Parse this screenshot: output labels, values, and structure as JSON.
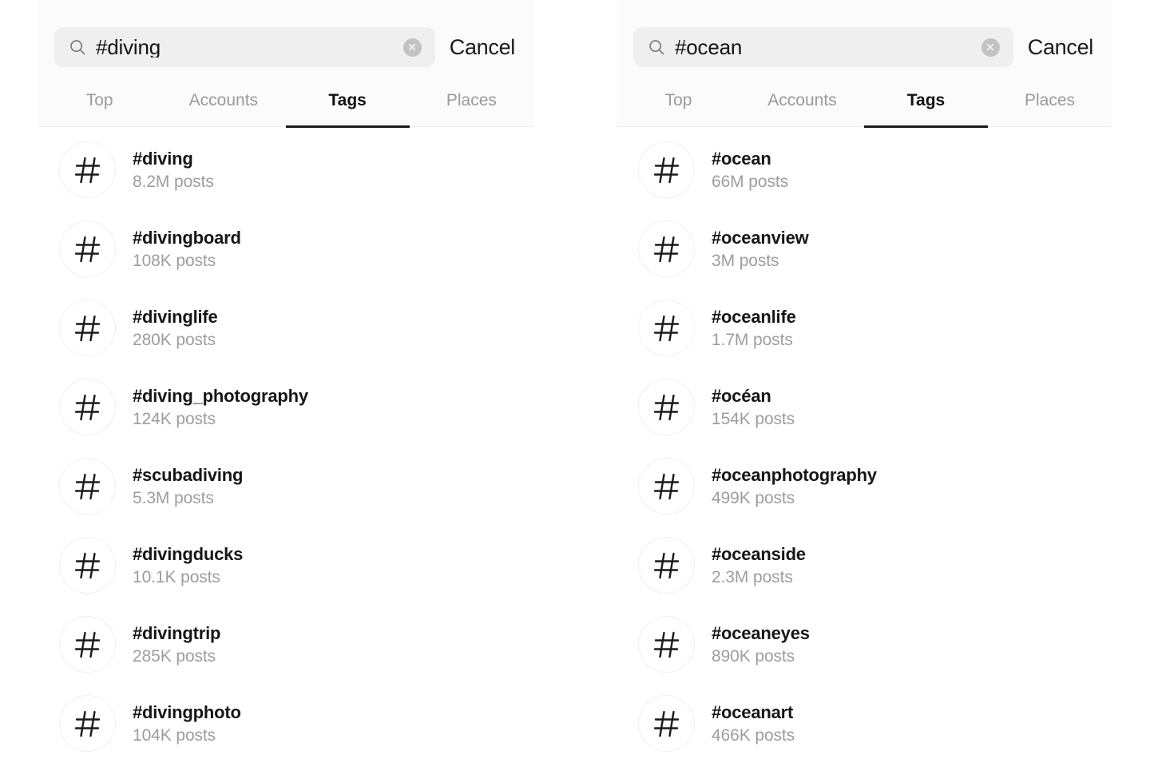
{
  "panels": [
    {
      "id": "left",
      "search": {
        "value": "#diving",
        "placeholder": "Search",
        "search_icon": "search-icon",
        "clear_icon": "clear-circle-icon",
        "cancel_label": "Cancel"
      },
      "tabs": [
        {
          "label": "Top",
          "active": false
        },
        {
          "label": "Accounts",
          "active": false
        },
        {
          "label": "Tags",
          "active": true
        },
        {
          "label": "Places",
          "active": false
        }
      ],
      "results": [
        {
          "icon": "hashtag-icon",
          "tag": "#diving",
          "count": "8.2M posts"
        },
        {
          "icon": "hashtag-icon",
          "tag": "#divingboard",
          "count": "108K posts"
        },
        {
          "icon": "hashtag-icon",
          "tag": "#divinglife",
          "count": "280K posts"
        },
        {
          "icon": "hashtag-icon",
          "tag": "#diving_photography",
          "count": "124K posts"
        },
        {
          "icon": "hashtag-icon",
          "tag": "#scubadiving",
          "count": "5.3M posts"
        },
        {
          "icon": "hashtag-icon",
          "tag": "#divingducks",
          "count": "10.1K posts"
        },
        {
          "icon": "hashtag-icon",
          "tag": "#divingtrip",
          "count": "285K posts"
        },
        {
          "icon": "hashtag-icon",
          "tag": "#divingphoto",
          "count": "104K posts"
        }
      ]
    },
    {
      "id": "right",
      "search": {
        "value": "#ocean",
        "placeholder": "Search",
        "search_icon": "search-icon",
        "clear_icon": "clear-circle-icon",
        "cancel_label": "Cancel"
      },
      "tabs": [
        {
          "label": "Top",
          "active": false
        },
        {
          "label": "Accounts",
          "active": false
        },
        {
          "label": "Tags",
          "active": true
        },
        {
          "label": "Places",
          "active": false
        }
      ],
      "results": [
        {
          "icon": "hashtag-icon",
          "tag": "#ocean",
          "count": "66M posts"
        },
        {
          "icon": "hashtag-icon",
          "tag": "#oceanview",
          "count": "3M posts"
        },
        {
          "icon": "hashtag-icon",
          "tag": "#oceanlife",
          "count": "1.7M posts"
        },
        {
          "icon": "hashtag-icon",
          "tag": "#océan",
          "count": "154K posts"
        },
        {
          "icon": "hashtag-icon",
          "tag": "#oceanphotography",
          "count": "499K posts"
        },
        {
          "icon": "hashtag-icon",
          "tag": "#oceanside",
          "count": "2.3M posts"
        },
        {
          "icon": "hashtag-icon",
          "tag": "#oceaneyes",
          "count": "890K posts"
        },
        {
          "icon": "hashtag-icon",
          "tag": "#oceanart",
          "count": "466K posts"
        }
      ]
    }
  ],
  "colors": {
    "page_background": "#ffffff",
    "panel_background": "#ffffff",
    "header_background": "#fbfbfb",
    "search_field_background": "#efefef",
    "active_text": "#121212",
    "inactive_text": "#9a9a9a",
    "secondary_text": "#9d9d9d",
    "active_underline": "#1a1a1a",
    "clear_button": "#c2c2c2",
    "divider": "#eceded"
  }
}
